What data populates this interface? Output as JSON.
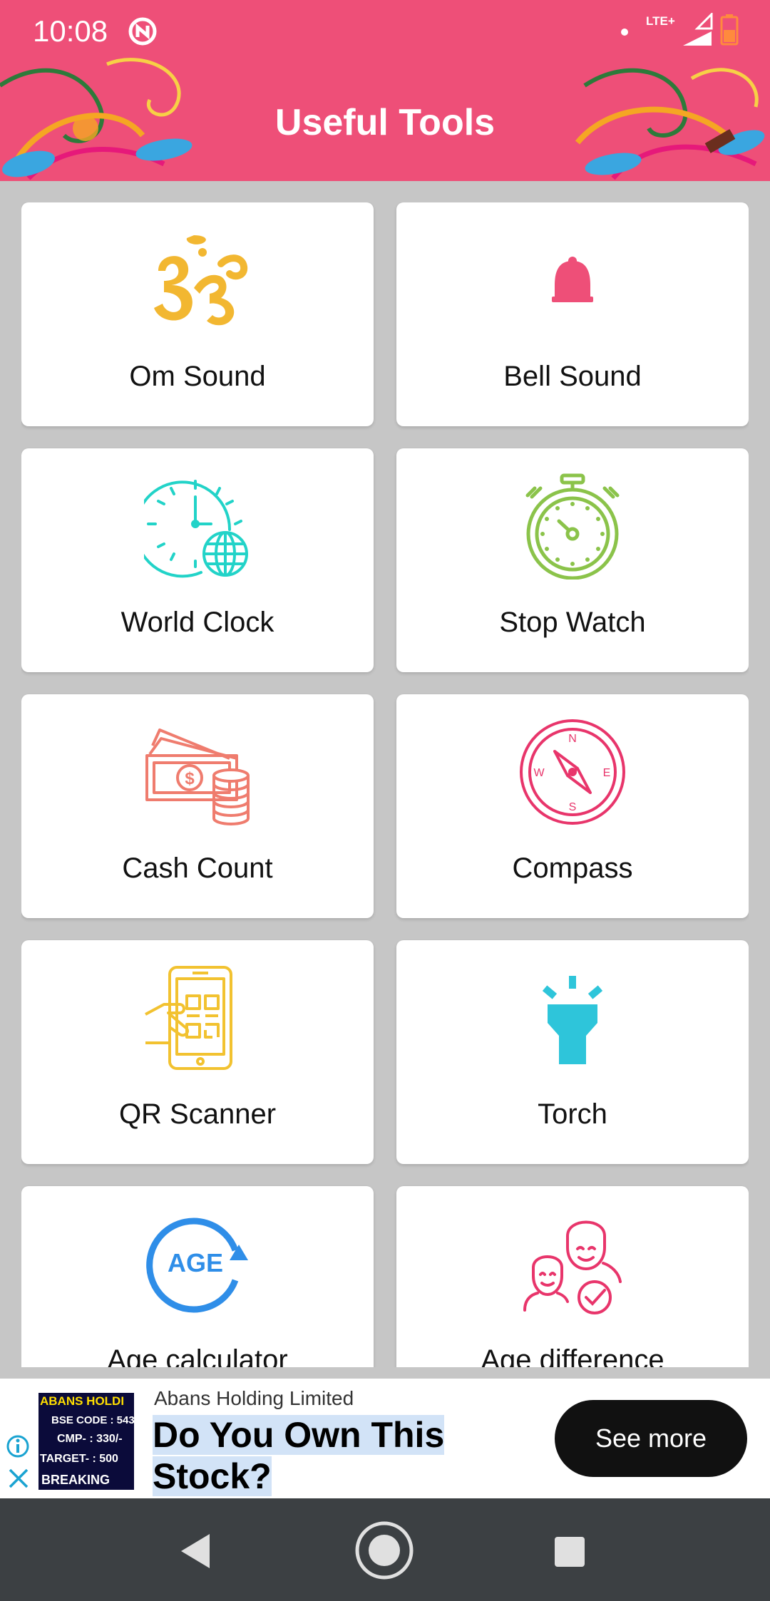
{
  "status_bar": {
    "time": "10:08",
    "network": "LTE+"
  },
  "header": {
    "title": "Useful Tools"
  },
  "tools": [
    {
      "label": "Om Sound",
      "icon": "om-icon"
    },
    {
      "label": "Bell Sound",
      "icon": "bell-icon"
    },
    {
      "label": "World Clock",
      "icon": "world-clock-icon"
    },
    {
      "label": "Stop Watch",
      "icon": "stopwatch-icon"
    },
    {
      "label": "Cash Count",
      "icon": "cash-icon"
    },
    {
      "label": "Compass",
      "icon": "compass-icon"
    },
    {
      "label": "QR Scanner",
      "icon": "qr-scanner-icon"
    },
    {
      "label": "Torch",
      "icon": "torch-icon"
    },
    {
      "label": "Age calculator",
      "icon": "age-icon"
    },
    {
      "label": "Age difference",
      "icon": "people-icon"
    }
  ],
  "icons": {
    "age_text": "AGE",
    "compass_n": "N",
    "compass_s": "S",
    "compass_e": "E",
    "compass_w": "W",
    "cash_symbol": "$"
  },
  "ad": {
    "company": "Abans Holding Limited",
    "headline": "Do You Own This Stock?",
    "cta": "See more",
    "thumb_lines": [
      "ABANS HOLDI",
      "BSE CODE : 543",
      "CMP- : 330/-",
      "TARGET- : 500",
      "BREAKING"
    ]
  },
  "colors": {
    "header": "#ee4f78",
    "background": "#c6c6c6",
    "om": "#f2b731",
    "bell": "#ee4f78",
    "world_clock": "#22d3c8",
    "stopwatch": "#8bc34a",
    "cash": "#ef7c6e",
    "compass": "#e8356b",
    "qr": "#f2c230",
    "torch": "#2ec5da",
    "age": "#2f8ee8",
    "people": "#e8356b"
  }
}
